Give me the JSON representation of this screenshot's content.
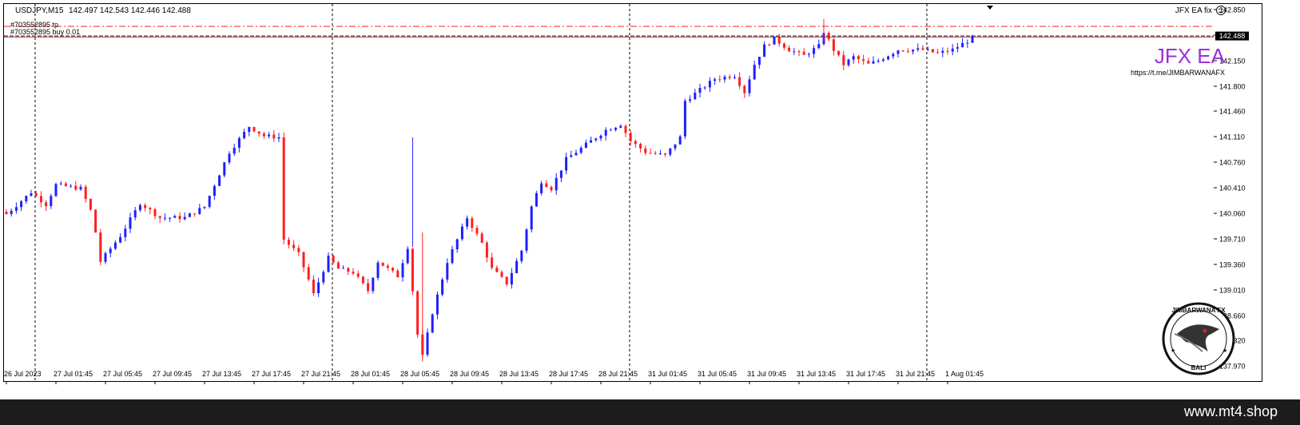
{
  "header": {
    "symbol_info": "USDJPY,M15",
    "ohlc": "142.497 142.543 142.446 142.488",
    "ea_status": "JFX EA fix"
  },
  "orders": {
    "tp_label": "#703552895 tp",
    "buy_label": "#703552895 buy 0.01"
  },
  "brand": {
    "title": "JFX EA",
    "url": "https://t.me/JIMBARWANAFX",
    "logo_text": "JIMBARWANA FX",
    "logo_sub": "BALI"
  },
  "footer": {
    "site": "www.mt4.shop"
  },
  "colors": {
    "bull": "#1f1fff",
    "bear": "#ff1f1f",
    "tp_line": "#ff1f1f",
    "brand_title": "#9b30d8",
    "footer_bg": "#1c1c1c"
  },
  "chart_data": {
    "type": "candlestick",
    "symbol": "USDJPY",
    "timeframe": "M15",
    "current_price": "142.488",
    "tp_price": 142.62,
    "ylim": [
      137.97,
      142.85
    ],
    "y_ticks": [
      "142.850",
      "142.500",
      "142.150",
      "141.800",
      "141.460",
      "141.110",
      "140.760",
      "140.410",
      "140.060",
      "139.710",
      "139.360",
      "139.010",
      "138.660",
      "138.320",
      "137.970"
    ],
    "x_ticks": [
      "26 Jul 2023",
      "27 Jul 01:45",
      "27 Jul 05:45",
      "27 Jul 09:45",
      "27 Jul 13:45",
      "27 Jul 17:45",
      "27 Jul 21:45",
      "28 Jul 01:45",
      "28 Jul 05:45",
      "28 Jul 09:45",
      "28 Jul 13:45",
      "28 Jul 17:45",
      "28 Jul 21:45",
      "31 Jul 01:45",
      "31 Jul 05:45",
      "31 Jul 09:45",
      "31 Jul 13:45",
      "31 Jul 17:45",
      "31 Jul 21:45",
      "1 Aug 01:45"
    ],
    "x_tick_positions": [
      0,
      10,
      20,
      30,
      40,
      50,
      60,
      70,
      80,
      90,
      100,
      110,
      120,
      130,
      140,
      150,
      160,
      170,
      180,
      190
    ],
    "period_separators": [
      5.8,
      65.8,
      125.8,
      185.8
    ],
    "close_path": [
      [
        0,
        140.05
      ],
      [
        5,
        140.35
      ],
      [
        8,
        140.18
      ],
      [
        10,
        140.45
      ],
      [
        15,
        140.4
      ],
      [
        17,
        140.1
      ],
      [
        18,
        139.8
      ],
      [
        19,
        139.4
      ],
      [
        23,
        139.75
      ],
      [
        27,
        140.2
      ],
      [
        31,
        140.0
      ],
      [
        36,
        140.0
      ],
      [
        40,
        140.15
      ],
      [
        45,
        140.9
      ],
      [
        49,
        141.25
      ],
      [
        52,
        141.12
      ],
      [
        55,
        141.1
      ],
      [
        56,
        139.7
      ],
      [
        59,
        139.5
      ],
      [
        61,
        139.15
      ],
      [
        62,
        138.95
      ],
      [
        65,
        139.45
      ],
      [
        67,
        139.3
      ],
      [
        70,
        139.25
      ],
      [
        73,
        139.0
      ],
      [
        75,
        139.4
      ],
      [
        79,
        139.2
      ],
      [
        81,
        139.6
      ],
      [
        83,
        138.4
      ],
      [
        84,
        138.1
      ],
      [
        86,
        138.7
      ],
      [
        89,
        139.4
      ],
      [
        93,
        140.0
      ],
      [
        96,
        139.65
      ],
      [
        98,
        139.3
      ],
      [
        101,
        139.1
      ],
      [
        104,
        139.55
      ],
      [
        106,
        140.15
      ],
      [
        108,
        140.5
      ],
      [
        110,
        140.4
      ],
      [
        113,
        140.8
      ],
      [
        117,
        141.0
      ],
      [
        121,
        141.2
      ],
      [
        124,
        141.28
      ],
      [
        126,
        141.05
      ],
      [
        129,
        140.9
      ],
      [
        133,
        140.85
      ],
      [
        136,
        141.1
      ],
      [
        137,
        141.6
      ],
      [
        140,
        141.75
      ],
      [
        143,
        141.9
      ],
      [
        147,
        141.95
      ],
      [
        149,
        141.72
      ],
      [
        151,
        142.1
      ],
      [
        153,
        142.35
      ],
      [
        155,
        142.45
      ],
      [
        158,
        142.3
      ],
      [
        161,
        142.22
      ],
      [
        164,
        142.35
      ],
      [
        165,
        142.55
      ],
      [
        167,
        142.3
      ],
      [
        169,
        142.1
      ],
      [
        171,
        142.2
      ],
      [
        174,
        142.1
      ],
      [
        176,
        142.15
      ],
      [
        180,
        142.3
      ],
      [
        185,
        142.3
      ],
      [
        188,
        142.25
      ],
      [
        191,
        142.3
      ],
      [
        194,
        142.42
      ],
      [
        195,
        142.49
      ]
    ]
  }
}
